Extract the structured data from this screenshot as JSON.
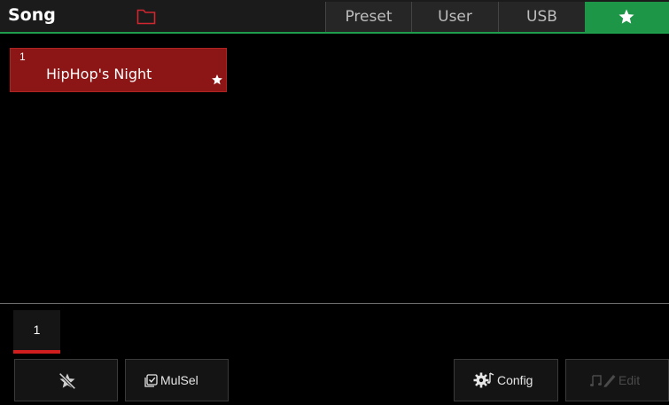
{
  "header": {
    "title": "Song",
    "folder_icon": "folder-icon",
    "accent_color": "#1f9d4c",
    "tabs": [
      {
        "label": "Preset"
      },
      {
        "label": "User"
      },
      {
        "label": "USB"
      },
      {
        "label": "",
        "icon": "star-icon",
        "active": true
      }
    ]
  },
  "songs": [
    {
      "number": "1",
      "name": "HipHop's Night",
      "favorite": true,
      "selected": true
    }
  ],
  "pagination": {
    "current_page": "1",
    "indicator_color": "#d01e1e"
  },
  "toolbar": {
    "unfavorite_icon": "star-remove-icon",
    "mulsel_label": "MulSel",
    "config_label": "Config",
    "edit_label": "Edit",
    "edit_enabled": false
  },
  "colors": {
    "selected_item": "#8c1515",
    "active_tab": "#1e9648"
  }
}
